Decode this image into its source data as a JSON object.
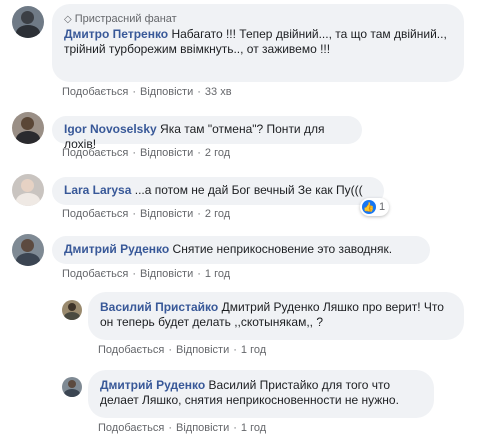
{
  "labels": {
    "like": "Подобається",
    "reply": "Відповісти",
    "dot": "·"
  },
  "comments": [
    {
      "badge": "Пристрасний фанат",
      "author": "Дмитро Петренко",
      "text": "Набагато !!! Тепер двійний..., та що там двійний.., трійний турборежим ввімкнуть.., от заживемо !!!",
      "time": "33 хв"
    },
    {
      "author": "Igor Novoselsky",
      "text": "Яка там \"отмена\"? Понти для лохів!",
      "time": "2 год"
    },
    {
      "author": "Lara Larysa",
      "text": "...а потом не дай Бог вечный Зе как Пу(((",
      "time": "2 год",
      "reaction_count": "1"
    },
    {
      "author": "Дмитрий Руденко",
      "text": "Снятие неприкосновение это заводняк.",
      "time": "1 год"
    },
    {
      "author": "Василий Пристайко",
      "text": "Дмитрий Руденко Ляшко про верит! Что он теперь будет делать ,,скотынякам,, ?",
      "time": "1 год"
    },
    {
      "author": "Дмитрий Руденко",
      "text": "Василий Пристайко для того что делает Ляшко, снятия неприкосновенности не нужно.",
      "time": "1 год"
    }
  ]
}
